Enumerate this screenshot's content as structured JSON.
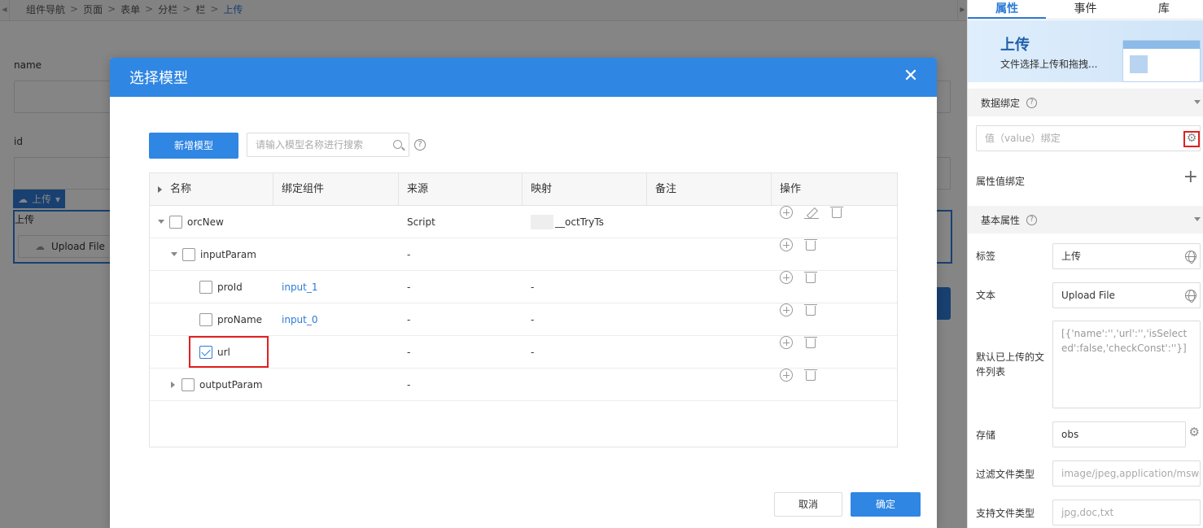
{
  "breadcrumb": [
    "组件导航",
    "页面",
    "表单",
    "分栏",
    "栏",
    "上传"
  ],
  "canvas": {
    "fields": [
      {
        "label": "name"
      },
      {
        "label": "id"
      }
    ],
    "upload_tag": "上传",
    "upload_label": "上传",
    "upload_button": "Upload File"
  },
  "panel": {
    "tabs": [
      "属性",
      "事件",
      "库"
    ],
    "active_tab": "属性",
    "hero": {
      "title": "上传",
      "desc": "文件选择上传和拖拽..."
    },
    "data_binding": {
      "title": "数据绑定",
      "value_binding_placeholder": "值（value）绑定",
      "attr_binding_label": "属性值绑定"
    },
    "basic": {
      "title": "基本属性",
      "rows": [
        {
          "label": "标签",
          "value": "上传"
        },
        {
          "label": "文本",
          "value": "Upload File"
        },
        {
          "label": "默认已上传的文件列表",
          "value": "[{'name':'','url':'','isSelected':false,'checkConst':''}]"
        },
        {
          "label": "存储",
          "value": "obs"
        },
        {
          "label": "过滤文件类型",
          "value": "image/jpeg,application/msword"
        },
        {
          "label": "支持文件类型",
          "value": "jpg,doc,txt"
        }
      ]
    }
  },
  "modal": {
    "title": "选择模型",
    "new_model_button": "新增模型",
    "search_placeholder": "请输入模型名称进行搜索",
    "columns": [
      "名称",
      "绑定组件",
      "来源",
      "映射",
      "备注",
      "操作"
    ],
    "rows": [
      {
        "name": "orcNew",
        "component": "",
        "source": "Script",
        "mapping": "__octTryTs",
        "note": "",
        "level": 0,
        "toggle": "down",
        "checked": false
      },
      {
        "name": "inputParam",
        "component": "",
        "source": "-",
        "mapping": "",
        "note": "",
        "level": 1,
        "toggle": "down",
        "checked": false
      },
      {
        "name": "proId",
        "component": "input_1",
        "source": "-",
        "mapping": "-",
        "note": "",
        "level": 2,
        "toggle": "none",
        "checked": false
      },
      {
        "name": "proName",
        "component": "input_0",
        "source": "-",
        "mapping": "-",
        "note": "",
        "level": 2,
        "toggle": "none",
        "checked": false
      },
      {
        "name": "url",
        "component": "",
        "source": "-",
        "mapping": "-",
        "note": "",
        "level": 2,
        "toggle": "none",
        "checked": true
      },
      {
        "name": "outputParam",
        "component": "",
        "source": "-",
        "mapping": "",
        "note": "",
        "level": 1,
        "toggle": "right",
        "checked": false
      }
    ],
    "cancel_button": "取消",
    "ok_button": "确定"
  },
  "colors": {
    "primary": "#2f86e3",
    "highlight": "#e02020"
  },
  "icons": [
    "search-icon",
    "help-icon",
    "close-icon",
    "add-icon",
    "edit-icon",
    "delete-icon",
    "gear-icon",
    "globe-icon",
    "plus-icon",
    "upload-cloud-icon"
  ]
}
